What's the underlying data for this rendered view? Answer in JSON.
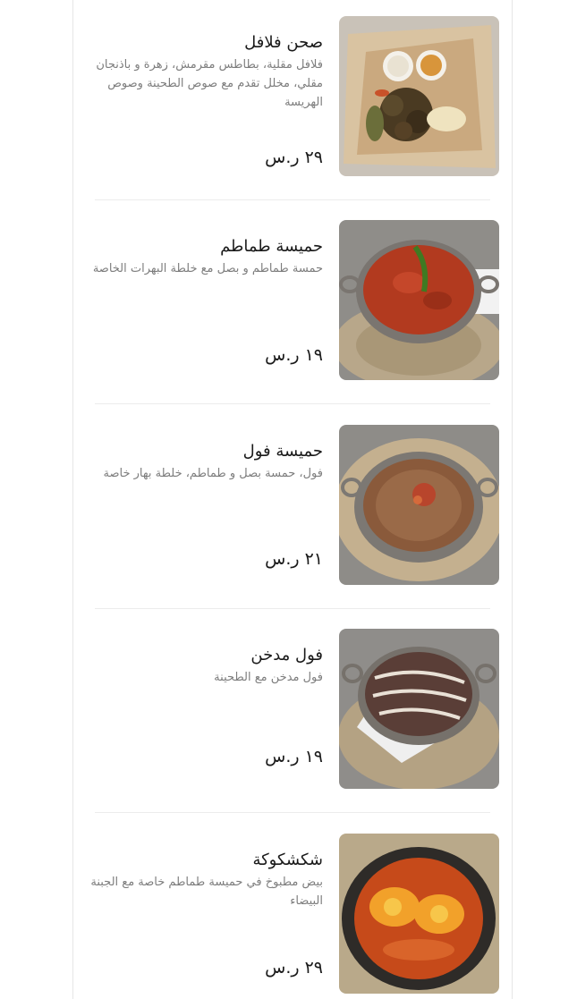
{
  "menu": {
    "items": [
      {
        "title": "صحن فلافل",
        "description": "فلافل مقلية، بطاطس مقرمش، زهرة و باذنجان مقلي، مخلل تقدم مع صوص الطحينة وصوص الهريسة",
        "price": "٢٩ ر.س",
        "image": "falafel-plate-image"
      },
      {
        "title": "حميسة طماطم",
        "description": "حمسة طماطم و بصل مع خلطة البهرات الخاصة",
        "price": "١٩ ر.س",
        "image": "tomato-stew-image"
      },
      {
        "title": "حميسة فول",
        "description": "فول، حمسة بصل و طماطم، خلطة بهار خاصة",
        "price": "٢١ ر.س",
        "image": "fava-stew-image"
      },
      {
        "title": "فول مدخن",
        "description": "فول مدخن مع الطحينة",
        "price": "١٩ ر.س",
        "image": "smoked-fava-image"
      },
      {
        "title": "شكشكوكة",
        "description": "بيض مطبوخ في حميسة طماطم خاصة مع الجبنة البيضاء",
        "price": "٢٩ ر.س",
        "image": "shakshuka-image"
      }
    ]
  }
}
